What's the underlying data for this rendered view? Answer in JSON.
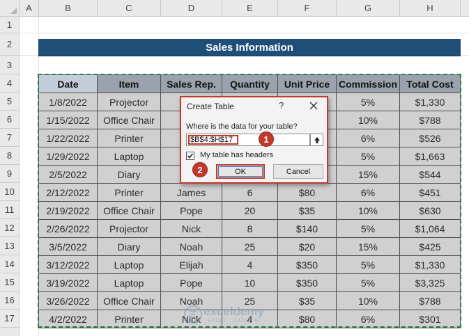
{
  "sheet": {
    "columns": [
      "A",
      "B",
      "C",
      "D",
      "E",
      "F",
      "G",
      "H"
    ],
    "rows": [
      "1",
      "2",
      "3",
      "4",
      "5",
      "6",
      "7",
      "8",
      "9",
      "10",
      "11",
      "12",
      "13",
      "14",
      "15",
      "16",
      "17"
    ]
  },
  "banner": {
    "title": "Sales Information"
  },
  "table": {
    "headers": [
      "Date",
      "Item",
      "Sales Rep.",
      "Quantity",
      "Unit Price",
      "Commission",
      "Total Cost"
    ],
    "rows": [
      [
        "1/8/2022",
        "Projector",
        "",
        "",
        "",
        "5%",
        "$1,330"
      ],
      [
        "1/15/2022",
        "Office Chair",
        "",
        "",
        "",
        "10%",
        "$788"
      ],
      [
        "1/22/2022",
        "Printer",
        "",
        "",
        "",
        "6%",
        "$526"
      ],
      [
        "1/29/2022",
        "Laptop",
        "",
        "",
        "",
        "5%",
        "$1,663"
      ],
      [
        "2/5/2022",
        "Diary",
        "",
        "",
        "",
        "15%",
        "$544"
      ],
      [
        "2/12/2022",
        "Printer",
        "James",
        "6",
        "$80",
        "6%",
        "$451"
      ],
      [
        "2/19/2022",
        "Office Chair",
        "Pope",
        "20",
        "$35",
        "10%",
        "$630"
      ],
      [
        "2/26/2022",
        "Projector",
        "Nick",
        "8",
        "$140",
        "5%",
        "$1,064"
      ],
      [
        "3/5/2022",
        "Diary",
        "Noah",
        "25",
        "$20",
        "15%",
        "$425"
      ],
      [
        "3/12/2022",
        "Laptop",
        "Elijah",
        "4",
        "$350",
        "5%",
        "$1,330"
      ],
      [
        "3/19/2022",
        "Laptop",
        "Pope",
        "10",
        "$350",
        "5%",
        "$3,325"
      ],
      [
        "3/26/2022",
        "Office Chair",
        "Noah",
        "25",
        "$35",
        "10%",
        "$788"
      ],
      [
        "4/2/2022",
        "Printer",
        "Nick",
        "4",
        "$80",
        "6%",
        "$301"
      ]
    ]
  },
  "dialog": {
    "title": "Create Table",
    "help": "?",
    "prompt": "Where is the data for your table?",
    "range_value": "$B$4:$H$17",
    "checkbox_label": "My table has headers",
    "checkbox_checked": true,
    "ok_label": "OK",
    "cancel_label": "Cancel"
  },
  "callouts": {
    "step1": "1",
    "step2": "2"
  },
  "watermark": {
    "brand": "exceldemy",
    "tagline": "EXCEL · DATA · BI"
  },
  "colors": {
    "banner": "#1f4e79",
    "header_fill": "#9aa3ad",
    "cell_fill": "#d0d0d0",
    "marquee": "#2e7d4f",
    "callout": "#c0392b"
  }
}
